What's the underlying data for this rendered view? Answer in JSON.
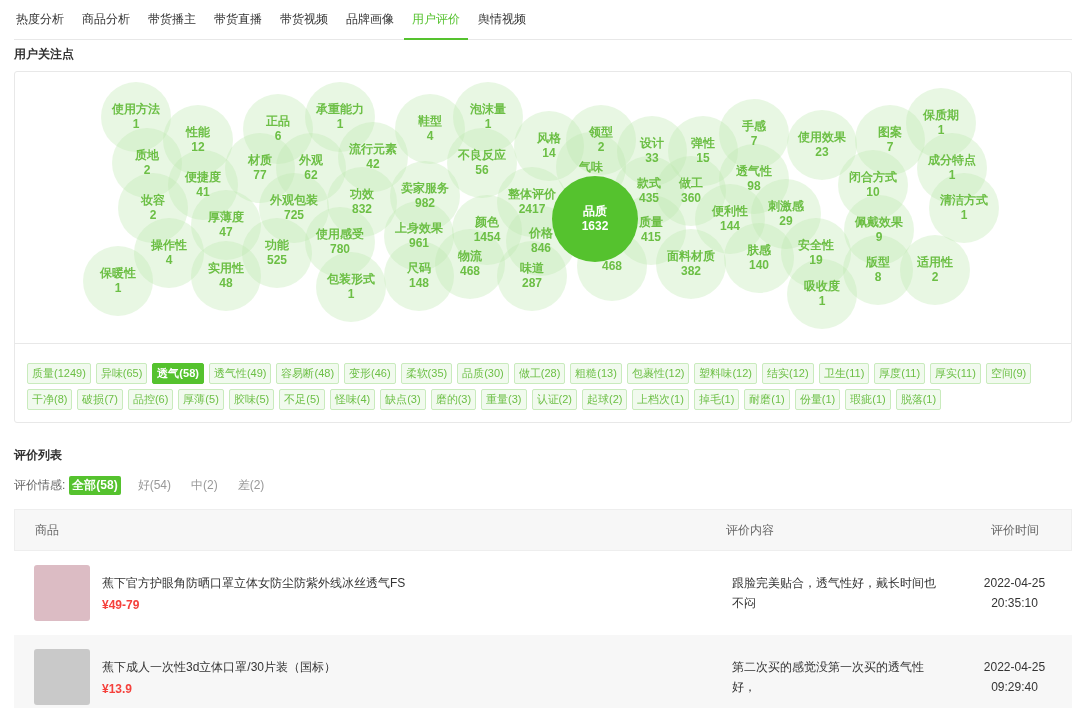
{
  "tabs": [
    {
      "label": "热度分析",
      "selected": false
    },
    {
      "label": "商品分析",
      "selected": false
    },
    {
      "label": "带货播主",
      "selected": false
    },
    {
      "label": "带货直播",
      "selected": false
    },
    {
      "label": "带货视频",
      "selected": false
    },
    {
      "label": "品牌画像",
      "selected": false
    },
    {
      "label": "用户评价",
      "selected": true
    },
    {
      "label": "舆情视频",
      "selected": false
    }
  ],
  "focus_section": {
    "title": "用户关注点",
    "keywords": [
      {
        "label": "使用方法",
        "value": "1",
        "selected": false
      },
      {
        "label": "性能",
        "value": "12",
        "selected": false
      },
      {
        "label": "质地",
        "value": "2",
        "selected": false
      },
      {
        "label": "正品",
        "value": "6",
        "selected": false
      },
      {
        "label": "承重能力",
        "value": "1",
        "selected": false
      },
      {
        "label": "材质",
        "value": "77",
        "selected": false
      },
      {
        "label": "外观",
        "value": "62",
        "selected": false
      },
      {
        "label": "流行元素",
        "value": "42",
        "selected": false
      },
      {
        "label": "鞋型",
        "value": "4",
        "selected": false
      },
      {
        "label": "泡沫量",
        "value": "1",
        "selected": false
      },
      {
        "label": "便捷度",
        "value": "41",
        "selected": false
      },
      {
        "label": "妆容",
        "value": "2",
        "selected": false
      },
      {
        "label": "外观包装",
        "value": "725",
        "selected": false
      },
      {
        "label": "功效",
        "value": "832",
        "selected": false
      },
      {
        "label": "卖家服务",
        "value": "982",
        "selected": false
      },
      {
        "label": "不良反应",
        "value": "56",
        "selected": false
      },
      {
        "label": "风格",
        "value": "14",
        "selected": false
      },
      {
        "label": "领型",
        "value": "2",
        "selected": false
      },
      {
        "label": "设计",
        "value": "33",
        "selected": false
      },
      {
        "label": "弹性",
        "value": "15",
        "selected": false
      },
      {
        "label": "手感",
        "value": "7",
        "selected": false
      },
      {
        "label": "使用效果",
        "value": "23",
        "selected": false
      },
      {
        "label": "图案",
        "value": "7",
        "selected": false
      },
      {
        "label": "保质期",
        "value": "1",
        "selected": false
      },
      {
        "label": "厚薄度",
        "value": "47",
        "selected": false
      },
      {
        "label": "上身效果",
        "value": "961",
        "selected": false
      },
      {
        "label": "整体评价",
        "value": "2417",
        "selected": false
      },
      {
        "label": "气味",
        "selected": false
      },
      {
        "label": "款式",
        "value": "435",
        "selected": false
      },
      {
        "label": "做工",
        "value": "360",
        "selected": false
      },
      {
        "label": "透气性",
        "value": "98",
        "selected": false
      },
      {
        "label": "闭合方式",
        "value": "10",
        "selected": false
      },
      {
        "label": "成分特点",
        "value": "1",
        "selected": false
      },
      {
        "label": "清洁方式",
        "value": "1",
        "selected": false
      },
      {
        "label": "操作性",
        "value": "4",
        "selected": false
      },
      {
        "label": "功能",
        "value": "525",
        "selected": false
      },
      {
        "label": "使用感受",
        "value": "780",
        "selected": false
      },
      {
        "label": "颜色",
        "value": "1454",
        "selected": false
      },
      {
        "label": "价格",
        "value": "846",
        "selected": false
      },
      {
        "label": "质量",
        "value": "415",
        "selected": false
      },
      {
        "label": "便利性",
        "value": "144",
        "selected": false
      },
      {
        "label": "刺激感",
        "value": "29",
        "selected": false
      },
      {
        "label": "佩戴效果",
        "value": "9",
        "selected": false
      },
      {
        "label": "保暖性",
        "value": "1",
        "selected": false
      },
      {
        "label": "实用性",
        "value": "48",
        "selected": false
      },
      {
        "label": "包装形式",
        "value": "1",
        "selected": false
      },
      {
        "label": "尺码",
        "value": "148",
        "selected": false
      },
      {
        "label": "物流",
        "value": "468",
        "selected": false
      },
      {
        "label": "味道",
        "value": "287",
        "selected": false
      },
      {
        "value": "468",
        "selected": false
      },
      {
        "label": "面料材质",
        "value": "382",
        "selected": false
      },
      {
        "label": "肤感",
        "value": "140",
        "selected": false
      },
      {
        "label": "安全性",
        "value": "19",
        "selected": false
      },
      {
        "label": "吸收度",
        "value": "1",
        "selected": false
      },
      {
        "label": "版型",
        "value": "8",
        "selected": false
      },
      {
        "label": "适用性",
        "value": "2",
        "selected": false
      },
      {
        "label": "品质",
        "value": "1632",
        "selected": true
      }
    ],
    "tags": [
      {
        "label": "质量(1249)",
        "selected": false
      },
      {
        "label": "异味(65)",
        "selected": false
      },
      {
        "label": "透气(58)",
        "selected": true
      },
      {
        "label": "透气性(49)",
        "selected": false
      },
      {
        "label": "容易断(48)",
        "selected": false
      },
      {
        "label": "变形(46)",
        "selected": false
      },
      {
        "label": "柔软(35)",
        "selected": false
      },
      {
        "label": "品质(30)",
        "selected": false
      },
      {
        "label": "做工(28)",
        "selected": false
      },
      {
        "label": "粗糙(13)",
        "selected": false
      },
      {
        "label": "包裹性(12)",
        "selected": false
      },
      {
        "label": "塑料味(12)",
        "selected": false
      },
      {
        "label": "结实(12)",
        "selected": false
      },
      {
        "label": "卫生(11)",
        "selected": false
      },
      {
        "label": "厚度(11)",
        "selected": false
      },
      {
        "label": "厚实(11)",
        "selected": false
      },
      {
        "label": "空间(9)",
        "selected": false
      },
      {
        "label": "干净(8)",
        "selected": false
      },
      {
        "label": "破损(7)",
        "selected": false
      },
      {
        "label": "品控(6)",
        "selected": false
      },
      {
        "label": "厚薄(5)",
        "selected": false
      },
      {
        "label": "胶味(5)",
        "selected": false
      },
      {
        "label": "不足(5)",
        "selected": false
      },
      {
        "label": "怪味(4)",
        "selected": false
      },
      {
        "label": "缺点(3)",
        "selected": false
      },
      {
        "label": "磨的(3)",
        "selected": false
      },
      {
        "label": "重量(3)",
        "selected": false
      },
      {
        "label": "认证(2)",
        "selected": false
      },
      {
        "label": "起球(2)",
        "selected": false
      },
      {
        "label": "上档次(1)",
        "selected": false
      },
      {
        "label": "掉毛(1)",
        "selected": false
      },
      {
        "label": "耐磨(1)",
        "selected": false
      },
      {
        "label": "份量(1)",
        "selected": false
      },
      {
        "label": "瑕疵(1)",
        "selected": false
      },
      {
        "label": "脱落(1)",
        "selected": false
      }
    ]
  },
  "review_section": {
    "title": "评价列表",
    "filter_label": "评价情感:",
    "filters": [
      {
        "label": "全部(58)",
        "selected": true
      },
      {
        "label": "好(54)",
        "selected": false
      },
      {
        "label": "中(2)",
        "selected": false
      },
      {
        "label": "差(2)",
        "selected": false
      }
    ],
    "columns": [
      "商品",
      "评价内容",
      "评价时间"
    ],
    "rows": [
      {
        "product": "蕉下官方护眼角防晒口罩立体女防尘防紫外线冰丝透气FS",
        "price": "¥49-79",
        "content": "跟脸完美贴合，透气性好，戴长时间也不闷",
        "date": "2022-04-25",
        "time": "20:35:10"
      },
      {
        "product": "蕉下成人一次性3d立体口罩/30片装（国标）",
        "price": "¥13.9",
        "content": "第二次买的感觉没第一次买的透气性好，",
        "date": "2022-04-25",
        "time": "09:29:40"
      }
    ]
  }
}
